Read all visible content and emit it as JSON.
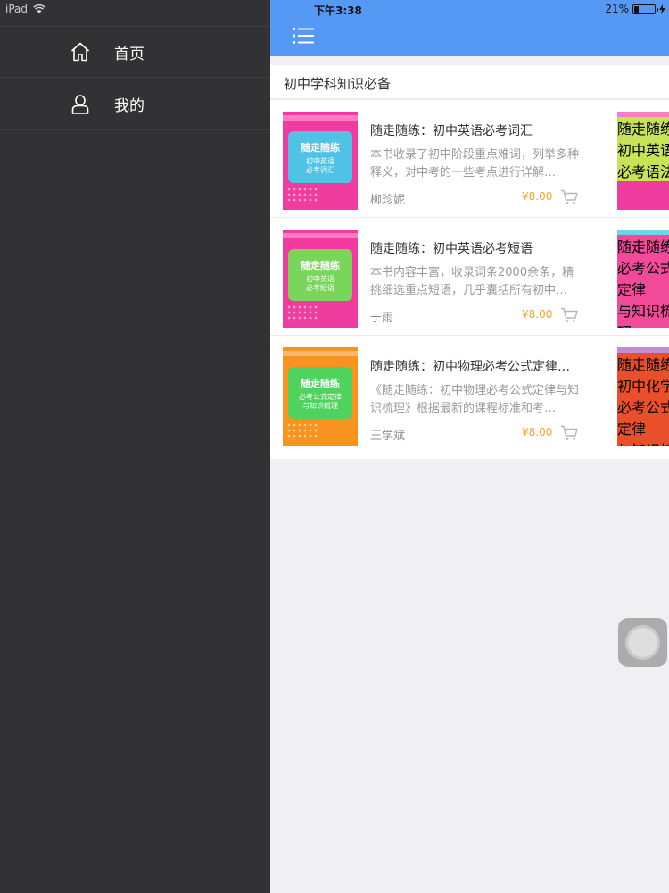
{
  "status_bar": {
    "device": "iPad",
    "time": "下午3:38",
    "battery_percent": "21%",
    "battery_level": 0.21
  },
  "sidemenu": {
    "items": [
      {
        "label": "首页",
        "icon": "home-icon"
      },
      {
        "label": "我的",
        "icon": "user-icon"
      }
    ]
  },
  "navbar": {
    "menu_icon": "list-menu-icon",
    "color": "#5599f5"
  },
  "section": {
    "title": "初中学科知识必备"
  },
  "books": [
    {
      "title": "随走随练：初中英语必考词汇",
      "description": "本书收录了初中阶段重点难词，列举多种释义，对中考的一些考点进行详解…",
      "author": "柳珍妮",
      "price": "¥8.00",
      "cover": {
        "top": "#f33aa0",
        "block": "#4fc2e6",
        "bottom": "#ee3d9e",
        "title": "随走随练",
        "subtitle": "初中英语\n必考词汇"
      },
      "next_cover": {
        "top": "#f33aa0",
        "block": "#c8e35a",
        "bottom": "#ee3d9e",
        "title": "随走随练",
        "subtitle": "初中英语\n必考语法"
      }
    },
    {
      "title": "随走随练：初中英语必考短语",
      "description": "本书内容丰富，收录词条2000余条，精挑细选重点短语，几乎囊括所有初中…",
      "author": "于雨",
      "price": "¥8.00",
      "cover": {
        "top": "#f33aa0",
        "block": "#7ad65b",
        "bottom": "#ee3d9e",
        "title": "随走随练",
        "subtitle": "初中英语\n必考短语"
      },
      "next_cover": {
        "top": "#2ab8e0",
        "block": "#f24a9a",
        "bottom": "#2ab8e0",
        "title": "随走随练",
        "subtitle": "必考公式定律\n与知识梳理"
      }
    },
    {
      "title": "随走随练：初中物理必考公式定律…",
      "description": "《随走随练：初中物理必考公式定律与知识梳理》根据最新的课程标准和考…",
      "author": "王学斌",
      "price": "¥8.00",
      "cover": {
        "top": "#f7931e",
        "block": "#4fd35e",
        "bottom": "#f7931e",
        "title": "随走随练",
        "subtitle": "必考公式定律\n与知识梳理"
      },
      "next_cover": {
        "top": "#a54ec8",
        "block": "#ea4f2b",
        "bottom": "#a54ec8",
        "title": "随走随练",
        "subtitle": "初中化学\n必考公式定律\n与知识梳理"
      }
    }
  ]
}
